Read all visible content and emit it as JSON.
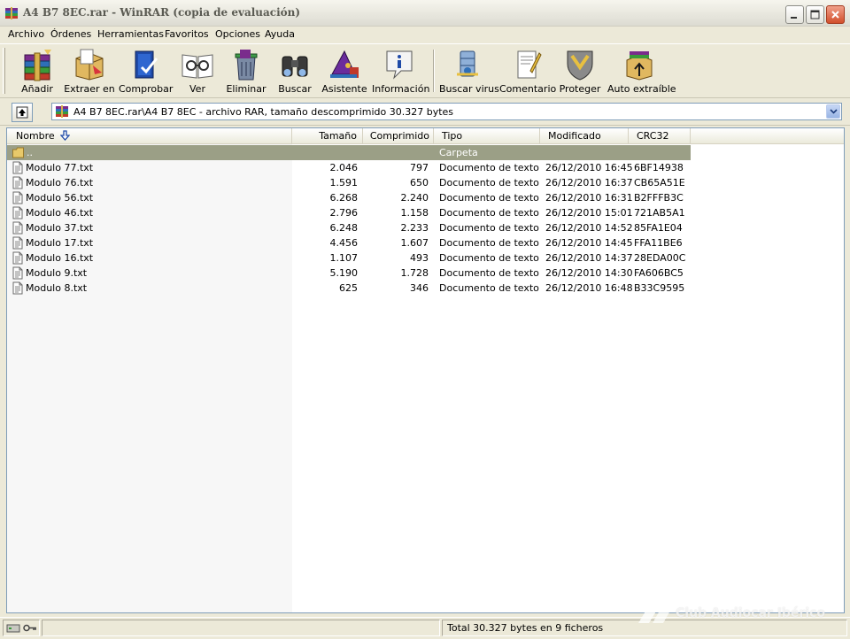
{
  "window": {
    "title": "A4 B7 8EC.rar - WinRAR (copia de evaluación)"
  },
  "menu": [
    "Archivo",
    "Órdenes",
    "Herramientas",
    "Favoritos",
    "Opciones",
    "Ayuda"
  ],
  "toolbar": [
    {
      "label": "Añadir",
      "icon": "add-archive-icon"
    },
    {
      "label": "Extraer en",
      "icon": "extract-icon"
    },
    {
      "label": "Comprobar",
      "icon": "test-icon"
    },
    {
      "label": "Ver",
      "icon": "view-icon"
    },
    {
      "label": "Eliminar",
      "icon": "delete-icon"
    },
    {
      "label": "Buscar",
      "icon": "find-icon"
    },
    {
      "label": "Asistente",
      "icon": "wizard-icon"
    },
    {
      "label": "Información",
      "icon": "info-icon"
    },
    {
      "label": "Buscar virus",
      "icon": "virus-scan-icon"
    },
    {
      "label": "Comentario",
      "icon": "comment-icon"
    },
    {
      "label": "Proteger",
      "icon": "protect-icon"
    },
    {
      "label": "Auto extraíble",
      "icon": "sfx-icon"
    }
  ],
  "address": {
    "path": "A4 B7 8EC.rar\\A4 B7 8EC - archivo RAR, tamaño descomprimido 30.327 bytes"
  },
  "columns": {
    "name": "Nombre",
    "size": "Tamaño",
    "packed": "Comprimido",
    "type": "Tipo",
    "modified": "Modificado",
    "crc": "CRC32"
  },
  "parent_row": {
    "name": "..",
    "type": "Carpeta"
  },
  "files": [
    {
      "name": "Modulo 77.txt",
      "size": "2.046",
      "packed": "797",
      "type": "Documento de texto",
      "modified": "26/12/2010 16:45",
      "crc": "6BF14938"
    },
    {
      "name": "Modulo 76.txt",
      "size": "1.591",
      "packed": "650",
      "type": "Documento de texto",
      "modified": "26/12/2010 16:37",
      "crc": "CB65A51E"
    },
    {
      "name": "Modulo 56.txt",
      "size": "6.268",
      "packed": "2.240",
      "type": "Documento de texto",
      "modified": "26/12/2010 16:31",
      "crc": "B2FFFB3C"
    },
    {
      "name": "Modulo 46.txt",
      "size": "2.796",
      "packed": "1.158",
      "type": "Documento de texto",
      "modified": "26/12/2010 15:01",
      "crc": "721AB5A1"
    },
    {
      "name": "Modulo 37.txt",
      "size": "6.248",
      "packed": "2.233",
      "type": "Documento de texto",
      "modified": "26/12/2010 14:52",
      "crc": "85FA1E04"
    },
    {
      "name": "Modulo 17.txt",
      "size": "4.456",
      "packed": "1.607",
      "type": "Documento de texto",
      "modified": "26/12/2010 14:45",
      "crc": "FFA11BE6"
    },
    {
      "name": "Modulo 16.txt",
      "size": "1.107",
      "packed": "493",
      "type": "Documento de texto",
      "modified": "26/12/2010 14:37",
      "crc": "28EDA00C"
    },
    {
      "name": "Modulo 9.txt",
      "size": "5.190",
      "packed": "1.728",
      "type": "Documento de texto",
      "modified": "26/12/2010 14:30",
      "crc": "FA606BC5"
    },
    {
      "name": "Modulo 8.txt",
      "size": "625",
      "packed": "346",
      "type": "Documento de texto",
      "modified": "26/12/2010 16:48",
      "crc": "B33C9595"
    }
  ],
  "status": {
    "summary": "Total 30.327 bytes en 9 ficheros"
  },
  "watermark": {
    "text": "Club Audiocar Ibérico"
  },
  "colors": {
    "selection": "#9b9f86",
    "border": "#7f9db9",
    "chrome": "#ece9d8"
  }
}
